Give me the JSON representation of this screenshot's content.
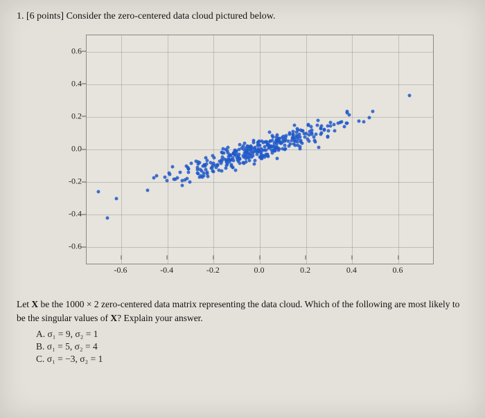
{
  "question": {
    "number": "1.",
    "points": "[6 points]",
    "prompt": "Consider the zero-centered data cloud pictured below."
  },
  "chart_data": {
    "type": "scatter",
    "xlim": [
      -0.75,
      0.75
    ],
    "ylim": [
      -0.7,
      0.7
    ],
    "xticks": [
      -0.6,
      -0.4,
      -0.2,
      0.0,
      0.2,
      0.4,
      0.6
    ],
    "yticks": [
      -0.6,
      -0.4,
      -0.2,
      0.0,
      0.2,
      0.4,
      0.6
    ],
    "xtick_labels": [
      "-0.6",
      "-0.4",
      "-0.2",
      "0.0",
      "0.2",
      "0.4",
      "0.6"
    ],
    "ytick_labels": [
      "-0.6",
      "-0.4",
      "-0.2",
      "0.0",
      "0.2",
      "0.4",
      "0.6"
    ],
    "title": "",
    "xlabel": "",
    "ylabel": "",
    "n_points": 1000,
    "principal_direction_slope": 0.45,
    "spread_major": 0.65,
    "spread_minor": 0.07
  },
  "below": {
    "line1a": "Let ",
    "Xbold": "X",
    "line1b": " be the 1000 × 2 zero-centered data matrix representing the data cloud. Which of the following are most likely to be the singular values of ",
    "Xbold2": "X",
    "line1c": "? Explain your answer."
  },
  "choices": {
    "A": {
      "label": "A.",
      "text": "σ₁ = 9, σ₂ = 1"
    },
    "B": {
      "label": "B.",
      "text": "σ₁ = 5, σ₂ = 4"
    },
    "C": {
      "label": "C.",
      "text": "σ₁ = −3, σ₂ = 1"
    }
  }
}
